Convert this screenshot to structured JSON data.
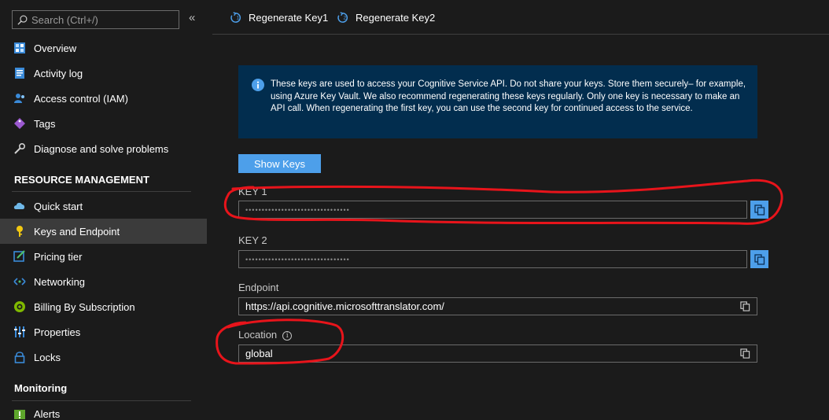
{
  "search": {
    "placeholder": "Search (Ctrl+/)"
  },
  "collapse_glyph": "«",
  "sidebar": {
    "top_items": [
      {
        "label": "Overview",
        "icon": "overview-icon"
      },
      {
        "label": "Activity log",
        "icon": "activity-log-icon"
      },
      {
        "label": "Access control (IAM)",
        "icon": "iam-icon"
      },
      {
        "label": "Tags",
        "icon": "tag-icon"
      },
      {
        "label": "Diagnose and solve problems",
        "icon": "wrench-icon"
      }
    ],
    "resource_management_title": "RESOURCE MANAGEMENT",
    "resource_items": [
      {
        "label": "Quick start",
        "icon": "cloud-icon"
      },
      {
        "label": "Keys and Endpoint",
        "icon": "key-icon",
        "active": true
      },
      {
        "label": "Pricing tier",
        "icon": "pricing-icon"
      },
      {
        "label": "Networking",
        "icon": "networking-icon"
      },
      {
        "label": "Billing By Subscription",
        "icon": "billing-icon"
      },
      {
        "label": "Properties",
        "icon": "properties-icon"
      },
      {
        "label": "Locks",
        "icon": "lock-icon"
      }
    ],
    "monitoring_title": "Monitoring",
    "monitoring_items": [
      {
        "label": "Alerts",
        "icon": "alert-icon"
      }
    ]
  },
  "toolbar": {
    "regen1_label": "Regenerate Key1",
    "regen2_label": "Regenerate Key2"
  },
  "info_banner": {
    "text": "These keys are used to access your Cognitive Service API. Do not share your keys. Store them securely– for example, using Azure Key Vault. We also recommend regenerating these keys regularly. Only one key is necessary to make an API call. When regenerating the first key, you can use the second key for continued access to the service."
  },
  "show_keys_label": "Show Keys",
  "key1": {
    "label": "KEY 1",
    "value": "••••••••••••••••••••••••••••••••"
  },
  "key2": {
    "label": "KEY 2",
    "value": "••••••••••••••••••••••••••••••••"
  },
  "endpoint": {
    "label": "Endpoint",
    "value": "https://api.cognitive.microsofttranslator.com/"
  },
  "location": {
    "label": "Location",
    "info_glyph": "i",
    "value": "global"
  },
  "colors": {
    "background": "#1b1b1b",
    "accent": "#4d9fea",
    "banner": "#022d4e",
    "annotation": "#e8141b",
    "active_item": "#3b3b3b"
  }
}
